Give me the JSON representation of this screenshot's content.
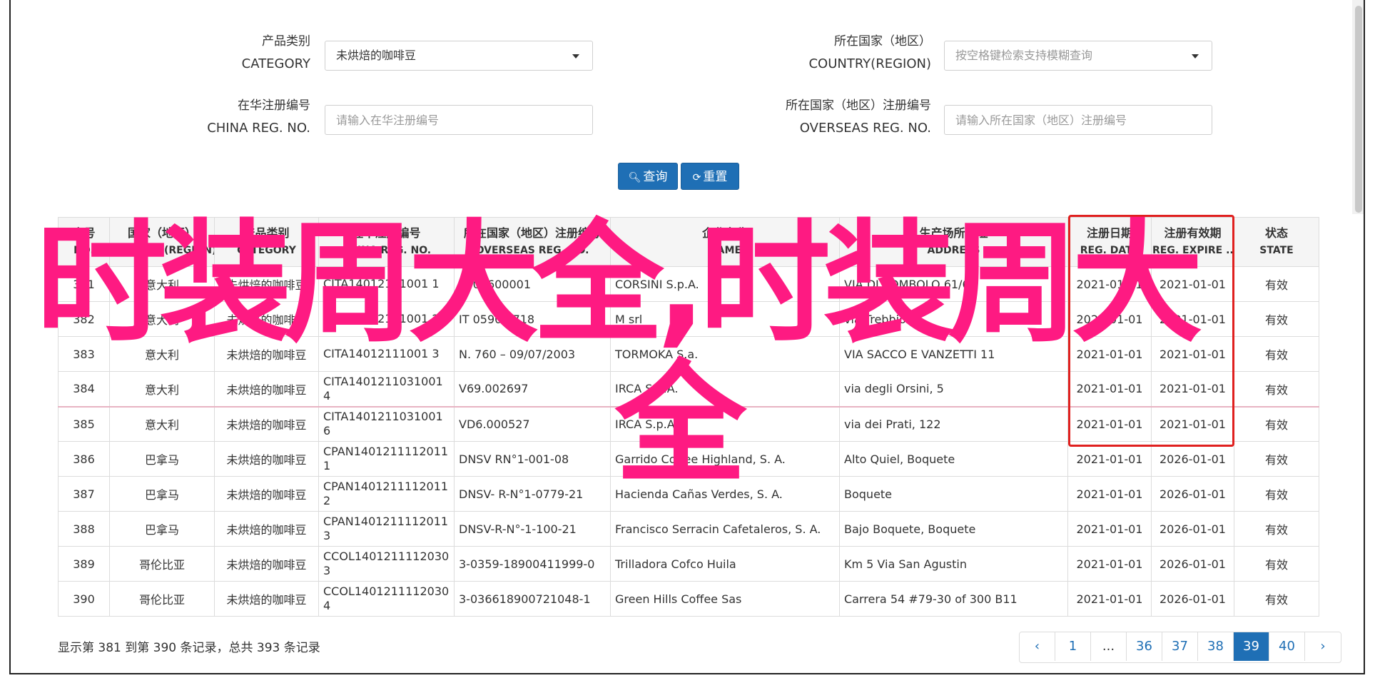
{
  "form": {
    "category_label_cn": "产品类别",
    "category_label_en": "CATEGORY",
    "category_value": "未烘焙的咖啡豆",
    "country_label_cn": "所在国家（地区）",
    "country_label_en": "COUNTRY(REGION)",
    "country_placeholder": "按空格键检索支持模糊查询",
    "china_reg_label_cn": "在华注册编号",
    "china_reg_label_en": "CHINA REG. NO.",
    "china_reg_placeholder": "请输入在华注册编号",
    "overseas_reg_label_cn": "所在国家（地区）注册编号",
    "overseas_reg_label_en": "OVERSEAS REG. NO.",
    "overseas_reg_placeholder": "请输入所在国家（地区）注册编号",
    "search_label": "查询",
    "reset_label": "重置"
  },
  "table": {
    "headers": [
      {
        "cn": "序号",
        "en": "NO."
      },
      {
        "cn": "国家（地区）",
        "en": "COUNTRY(REGION)"
      },
      {
        "cn": "产品类别",
        "en": "CATEGORY"
      },
      {
        "cn": "在华注册编号",
        "en": "CHINA REG. NO."
      },
      {
        "cn": "所在国家（地区）注册编号",
        "en": "OVERSEAS REG. NO."
      },
      {
        "cn": "企业名称",
        "en": "NAME"
      },
      {
        "cn": "生产场所地址",
        "en": "ADDRESS"
      },
      {
        "cn": "注册日期",
        "en": "REG. DATE"
      },
      {
        "cn": "注册有效期",
        "en": "REG. EXPIRE ..."
      },
      {
        "cn": "状态",
        "en": "STATE"
      }
    ],
    "rows": [
      [
        "381",
        "意大利",
        "未烘焙的咖啡豆",
        "CITA14012111001 1",
        "IT 01600001",
        "CORSINI S.p.A.",
        "VIA DI SOMBOLO 61/64",
        "2021-01-01",
        "2021-01-01",
        "有效"
      ],
      [
        "382",
        "意大利",
        "未烘焙的咖啡豆",
        "CITA14012111001 2",
        "IT 0590 0718",
        "M srl",
        "via Trebbio 21",
        "2021-01-01",
        "2021-01-01",
        "有效"
      ],
      [
        "383",
        "意大利",
        "未烘焙的咖啡豆",
        "CITA14012111001 3",
        "N. 760 – 09/07/2003",
        "TORMOKA S.a.",
        "VIA SACCO E VANZETTI 11",
        "2021-01-01",
        "2021-01-01",
        "有效"
      ],
      [
        "384",
        "意大利",
        "未烘焙的咖啡豆",
        "CITA14012110310014",
        "V69.002697",
        "IRCA S.p.A.",
        "via degli Orsini, 5",
        "2021-01-01",
        "2021-01-01",
        "有效"
      ],
      [
        "385",
        "意大利",
        "未烘焙的咖啡豆",
        "CITA14012110310016",
        "VD6.000527",
        "IRCA S.p.A.",
        "via dei Prati, 122",
        "2021-01-01",
        "2021-01-01",
        "有效"
      ],
      [
        "386",
        "巴拿马",
        "未烘焙的咖啡豆",
        "CPAN14012111120111",
        "DNSV RN°1-001-08",
        "Garrido Coffee Highland, S. A.",
        "Alto Quiel, Boquete",
        "2021-01-01",
        "2026-01-01",
        "有效"
      ],
      [
        "387",
        "巴拿马",
        "未烘焙的咖啡豆",
        "CPAN14012111120112",
        "DNSV- R-N°1-0779-21",
        "Hacienda Cañas Verdes, S. A.",
        "Boquete",
        "2021-01-01",
        "2026-01-01",
        "有效"
      ],
      [
        "388",
        "巴拿马",
        "未烘焙的咖啡豆",
        "CPAN14012111120113",
        "DNSV-R-N°-1-100-21",
        "Francisco Serracin Cafetaleros, S. A.",
        "Bajo Boquete, Boquete",
        "2021-01-01",
        "2026-01-01",
        "有效"
      ],
      [
        "389",
        "哥伦比亚",
        "未烘焙的咖啡豆",
        "CCOL14012111120303",
        "3-0359-18900411999-0",
        "Trilladora Cofco Huila",
        "Km 5 Via San Agustin",
        "2021-01-01",
        "2026-01-01",
        "有效"
      ],
      [
        "390",
        "哥伦比亚",
        "未烘焙的咖啡豆",
        "CCOL14012111120304",
        "3-036618900721048-1",
        "Green Hills Coffee Sas",
        "Carrera 54 #79-30 of 300 B11",
        "2021-01-01",
        "2026-01-01",
        "有效"
      ]
    ]
  },
  "overlay": {
    "line1": "时装周大全,时装周大",
    "line2": "全"
  },
  "footer": {
    "info": "显示第 381 到第 390 条记录，总共 393 条记录"
  },
  "pager": {
    "prev": "‹",
    "pages": [
      "1",
      "...",
      "36",
      "37",
      "38",
      "39",
      "40"
    ],
    "active": "39",
    "next": "›"
  },
  "colors": {
    "primary": "#1f6fb5",
    "overlay": "#fe1a82",
    "highlight_box": "#e0201f"
  }
}
